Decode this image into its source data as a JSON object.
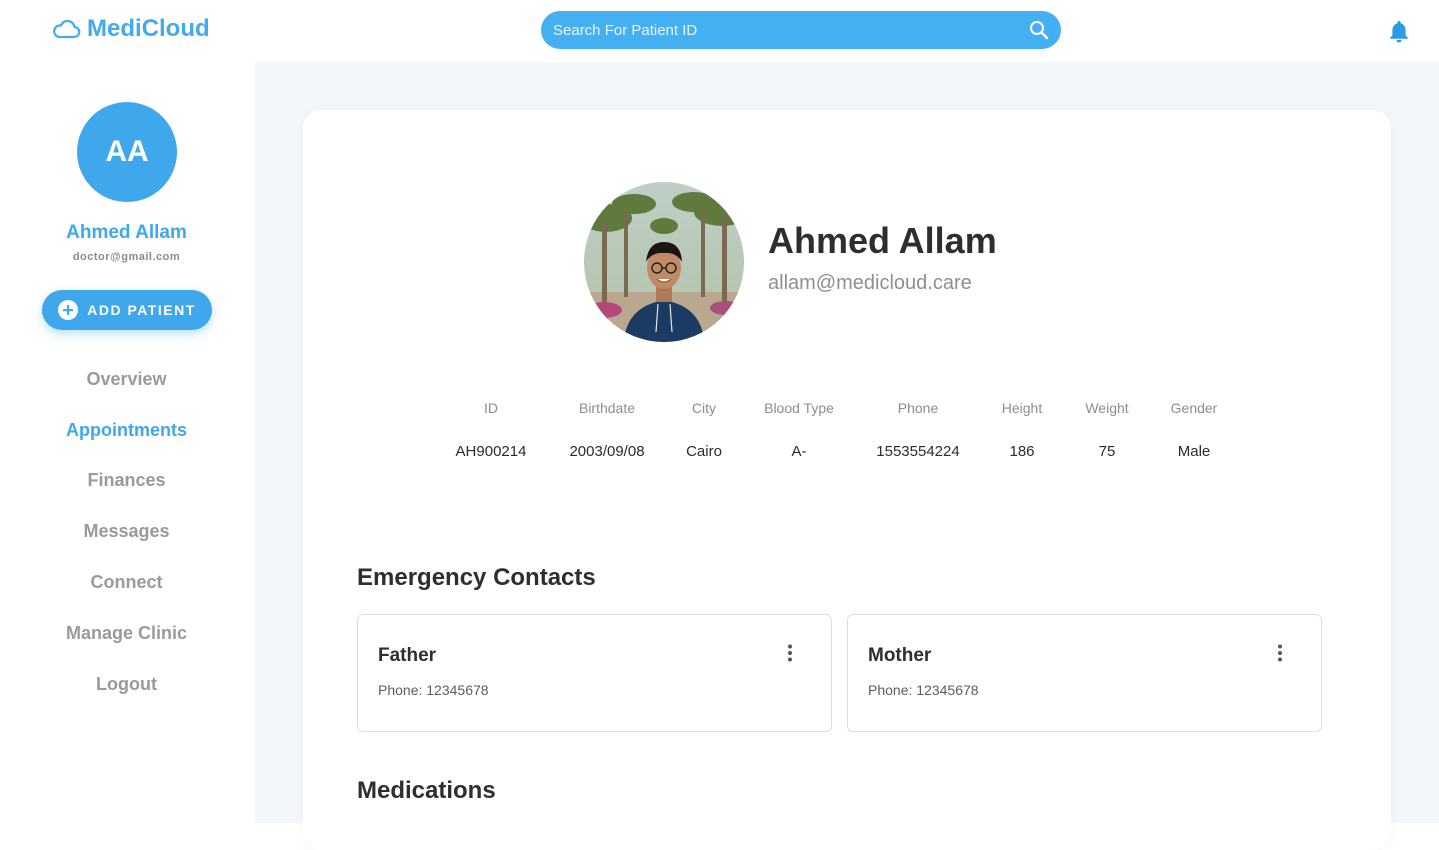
{
  "app": {
    "brand": "MediCloud",
    "brand_color": "#42abec"
  },
  "header": {
    "search_placeholder": "Search For Patient ID",
    "icons": [
      "search-icon",
      "bell-icon"
    ]
  },
  "sidebar": {
    "avatar_initials": "AA",
    "user_name": "Ahmed Allam",
    "user_email": "doctor@gmail.com",
    "add_patient_label": "ADD PATIENT",
    "items": [
      {
        "label": "Overview",
        "active": false
      },
      {
        "label": "Appointments",
        "active": true
      },
      {
        "label": "Finances",
        "active": false
      },
      {
        "label": "Messages",
        "active": false
      },
      {
        "label": "Connect",
        "active": false
      },
      {
        "label": "Manage Clinic",
        "active": false
      },
      {
        "label": "Logout",
        "active": false
      }
    ]
  },
  "patient": {
    "name": "Ahmed Allam",
    "email": "allam@medicloud.care",
    "info": {
      "headers": [
        "ID",
        "Birthdate",
        "City",
        "Blood Type",
        "Phone",
        "Height",
        "Weight",
        "Gender"
      ],
      "values": [
        "AH900214",
        "2003/09/08",
        "Cairo",
        "A-",
        "1553554224",
        "186",
        "75",
        "Male"
      ]
    }
  },
  "emergency": {
    "title": "Emergency Contacts",
    "contacts": [
      {
        "relation": "Father",
        "phone": "Phone: 12345678"
      },
      {
        "relation": "Mother",
        "phone": "Phone: 12345678"
      }
    ]
  },
  "medications": {
    "title": "Medications"
  }
}
